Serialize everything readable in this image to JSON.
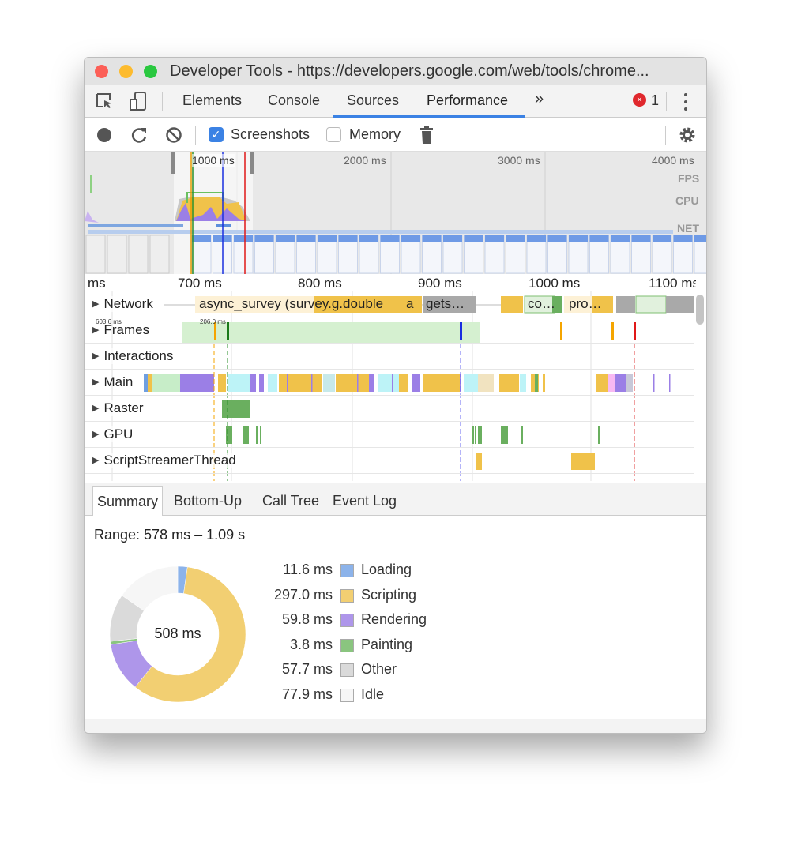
{
  "window": {
    "title": "Developer Tools - https://developers.google.com/web/tools/chrome..."
  },
  "tabs": [
    {
      "label": "Elements"
    },
    {
      "label": "Console"
    },
    {
      "label": "Sources"
    },
    {
      "label": "Performance",
      "active": true
    },
    {
      "label": "»"
    }
  ],
  "error_count": "1",
  "toolbar": {
    "screenshots_label": "Screenshots",
    "screenshots_checked": true,
    "memory_label": "Memory",
    "memory_checked": false
  },
  "overview": {
    "ticks": [
      "1000 ms",
      "2000 ms",
      "3000 ms",
      "4000 ms"
    ],
    "lanes": [
      "FPS",
      "CPU",
      "NET"
    ]
  },
  "timeline": {
    "ticks": [
      "ms",
      "700 ms",
      "800 ms",
      "900 ms",
      "1000 ms",
      "1100 ms"
    ],
    "tracks": [
      "Network",
      "Frames",
      "Interactions",
      "Main",
      "Raster",
      "GPU",
      "ScriptStreamerThread"
    ],
    "network_labels": [
      "async_survey (survey.g.double",
      "a",
      "gets…",
      "co…",
      "pro…"
    ],
    "frame_labels": [
      "603.6 ms",
      "206.0 ms"
    ]
  },
  "bottom_tabs": [
    {
      "label": "Summary",
      "active": true
    },
    {
      "label": "Bottom-Up"
    },
    {
      "label": "Call Tree"
    },
    {
      "label": "Event Log"
    }
  ],
  "summary": {
    "range": "Range: 578 ms – 1.09 s",
    "total": "508 ms",
    "items": [
      {
        "value": "11.6 ms",
        "label": "Loading",
        "ms": 11.6,
        "color": "#8cb3ea"
      },
      {
        "value": "297.0 ms",
        "label": "Scripting",
        "ms": 297.0,
        "color": "#f2cf72"
      },
      {
        "value": "59.8 ms",
        "label": "Rendering",
        "ms": 59.8,
        "color": "#ae96ea"
      },
      {
        "value": "3.8 ms",
        "label": "Painting",
        "ms": 3.8,
        "color": "#8ac57f"
      },
      {
        "value": "57.7 ms",
        "label": "Other",
        "ms": 57.7,
        "color": "#dadada"
      },
      {
        "value": "77.9 ms",
        "label": "Idle",
        "ms": 77.9,
        "color": "#f6f6f6"
      }
    ]
  },
  "colors": {
    "accent": "#3b82e4",
    "scripting": "#f0c24a",
    "rendering": "#9b7fe6",
    "painting": "#6aaf5f"
  }
}
